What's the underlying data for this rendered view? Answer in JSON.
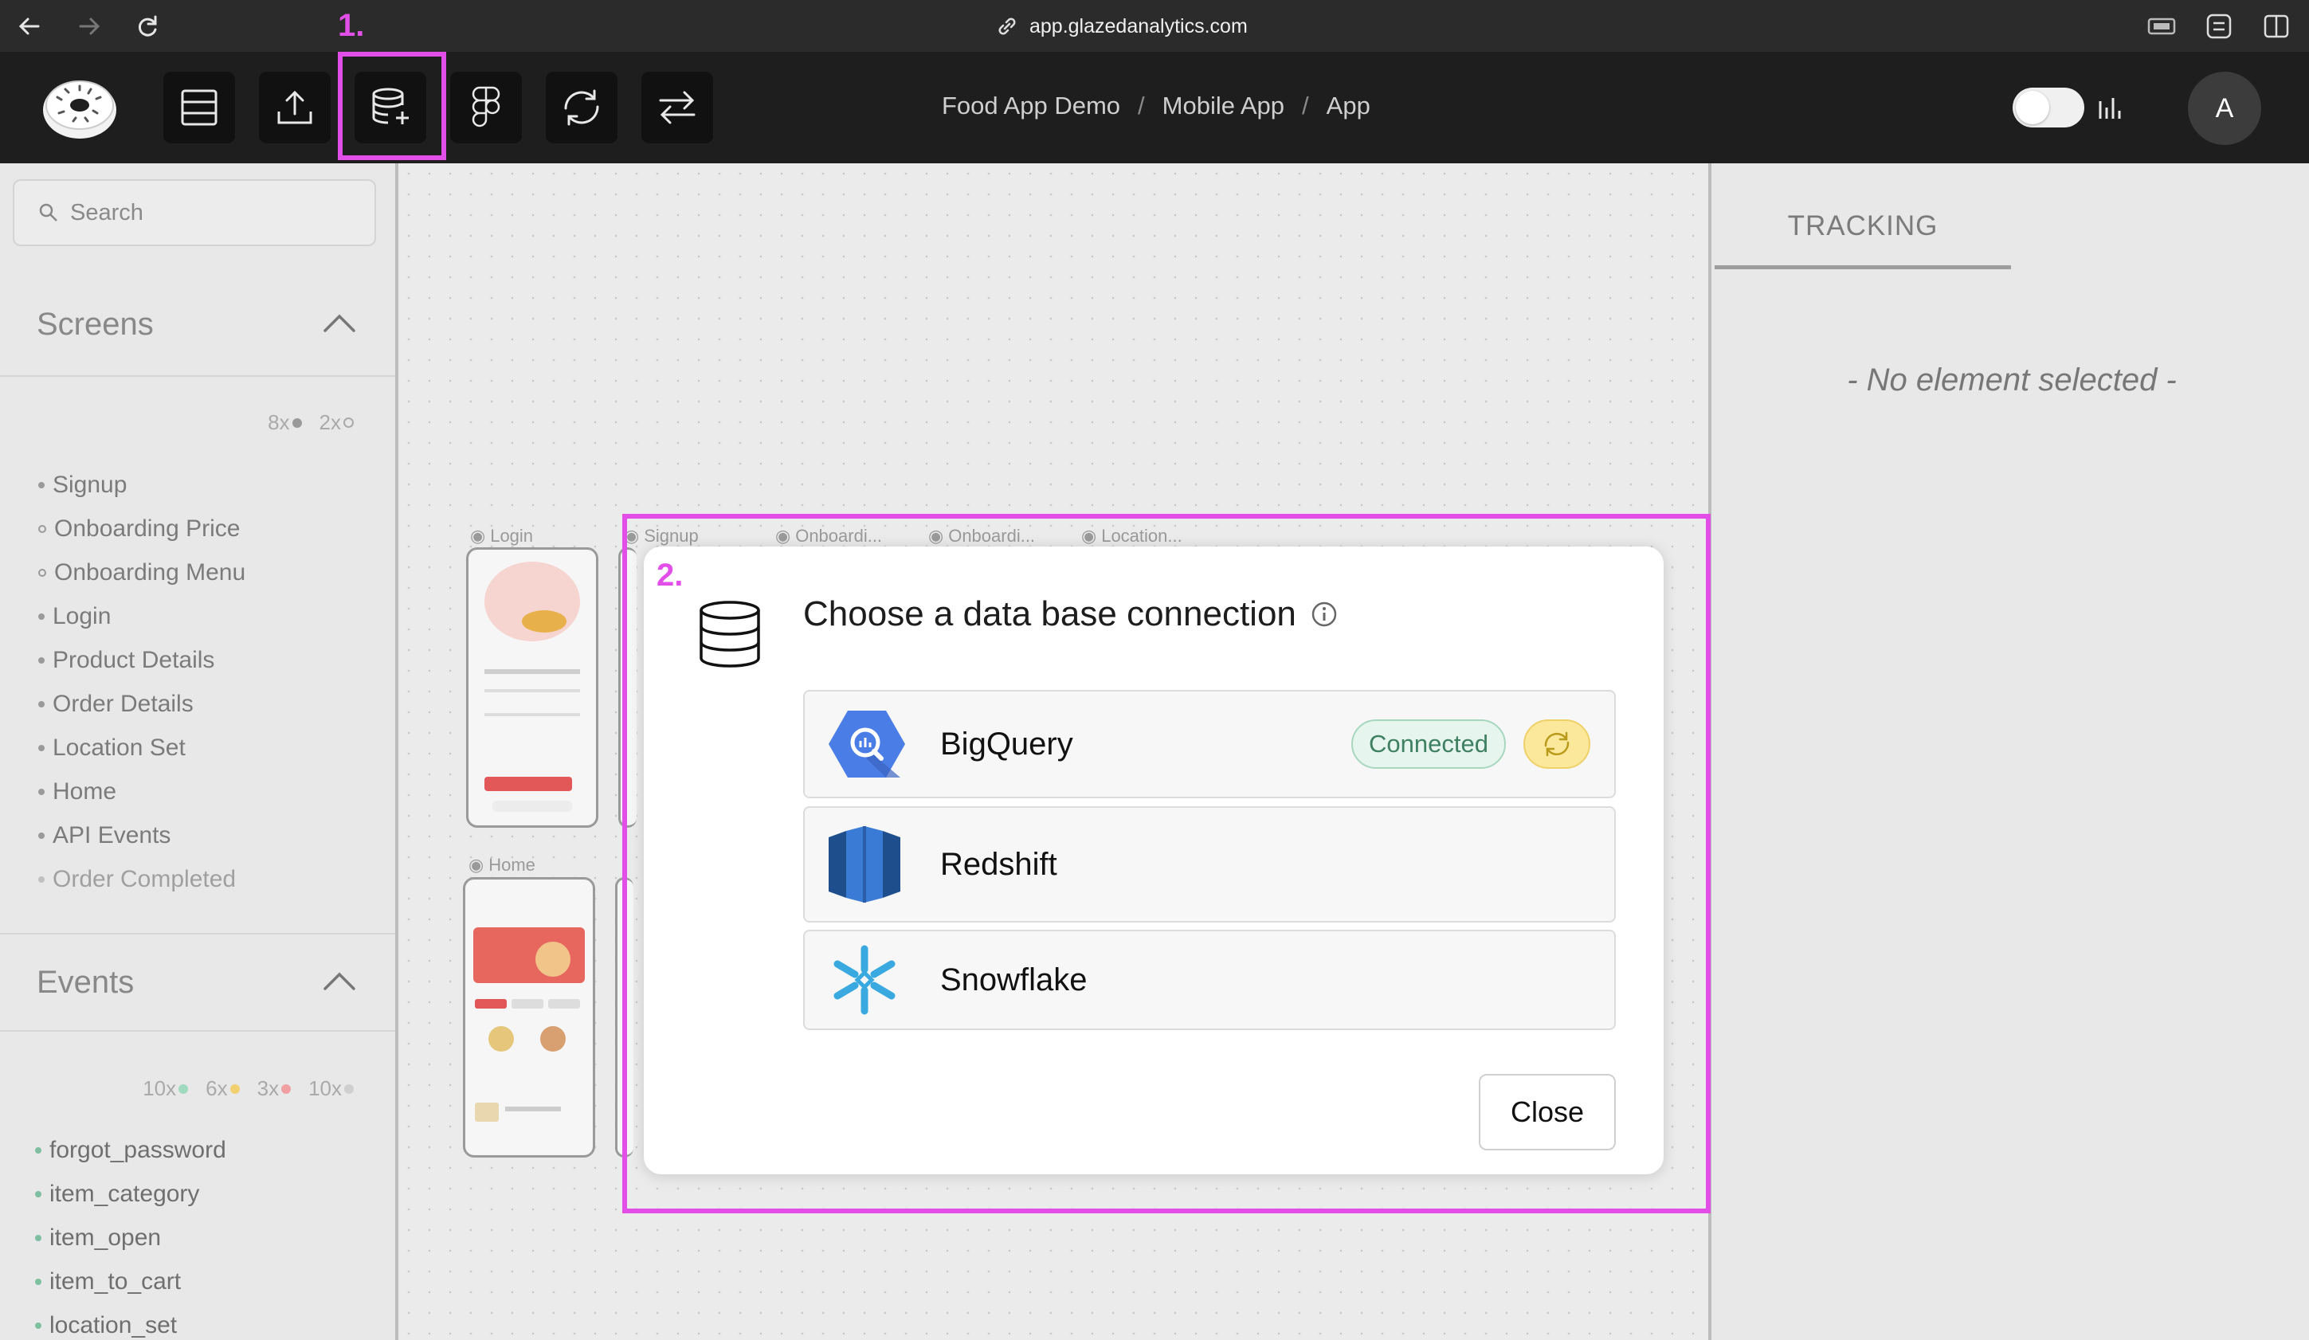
{
  "browser": {
    "url": "app.glazedanalytics.com"
  },
  "toolbar": {
    "highlight_1_label": "1.",
    "breadcrumb": [
      "Food App Demo",
      "Mobile App",
      "App"
    ],
    "breadcrumb_separator": "/",
    "avatar_initial": "A"
  },
  "sidebar": {
    "search_placeholder": "Search",
    "screens": {
      "title": "Screens",
      "counts": [
        {
          "label": "8x",
          "dot": "filled"
        },
        {
          "label": "2x",
          "dot": "hollow"
        }
      ],
      "items": [
        "Signup",
        "Onboarding Price",
        "Onboarding Menu",
        "Login",
        "Product Details",
        "Order Details",
        "Location Set",
        "Home",
        "API Events",
        "Order Completed"
      ]
    },
    "events": {
      "title": "Events",
      "counts": [
        {
          "label": "10x",
          "color": "#9fd9c0"
        },
        {
          "label": "6x",
          "color": "#f0d070"
        },
        {
          "label": "3x",
          "color": "#f0a0a0"
        },
        {
          "label": "10x",
          "color": "#cfcfcf"
        }
      ],
      "items": [
        "forgot_password",
        "item_category",
        "item_open",
        "item_to_cart",
        "location_set"
      ]
    }
  },
  "canvas": {
    "thumb_labels": [
      "Login",
      "Signup",
      "Onboardi...",
      "Onboardi...",
      "Location...",
      "Home"
    ]
  },
  "right_panel": {
    "tab_label": "TRACKING",
    "empty_text": "- No element selected -"
  },
  "modal": {
    "highlight_2_label": "2.",
    "title": "Choose a data base connection",
    "options": [
      {
        "name": "BigQuery",
        "status": "Connected"
      },
      {
        "name": "Redshift"
      },
      {
        "name": "Snowflake"
      }
    ],
    "close_label": "Close"
  },
  "colors": {
    "highlight": "#e24ee8",
    "connected_bg": "#e6f5ee",
    "connected_text": "#3f8063",
    "refresh_bg": "#fbe89a"
  }
}
